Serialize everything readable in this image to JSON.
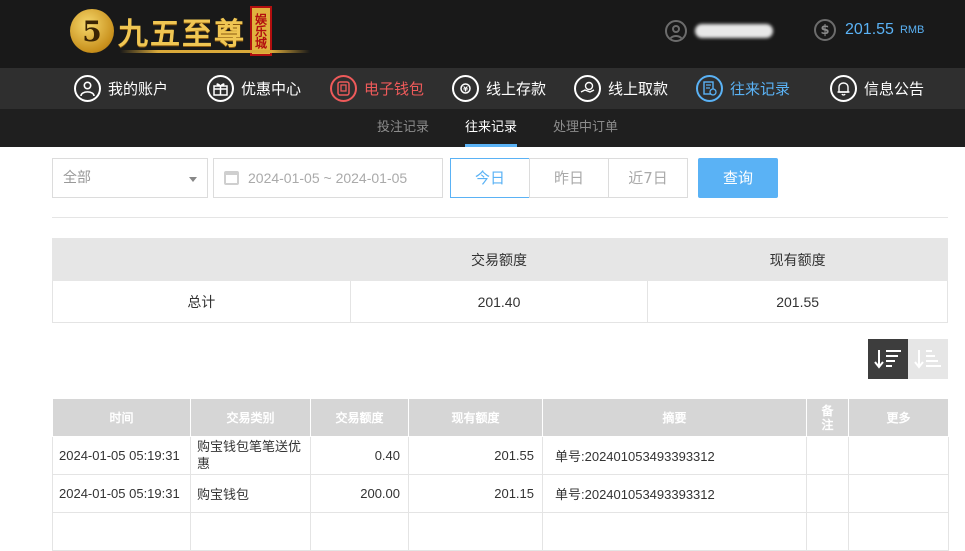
{
  "brand": {
    "logo_glyph": "5",
    "name": "九五至尊",
    "badge": "娱乐城"
  },
  "account": {
    "balance": "201.55",
    "currency": "RMB"
  },
  "nav": [
    {
      "label": "我的账户",
      "icon": "user-icon"
    },
    {
      "label": "优惠中心",
      "icon": "gift-icon"
    },
    {
      "label": "电子钱包",
      "icon": "wallet-icon"
    },
    {
      "label": "线上存款",
      "icon": "deposit-icon"
    },
    {
      "label": "线上取款",
      "icon": "withdraw-icon"
    },
    {
      "label": "往来记录",
      "icon": "records-icon"
    },
    {
      "label": "信息公告",
      "icon": "bell-icon"
    }
  ],
  "subnav": [
    {
      "label": "投注记录"
    },
    {
      "label": "往来记录"
    },
    {
      "label": "处理中订单"
    }
  ],
  "filters": {
    "type_selected": "全部",
    "date_range": "2024-01-05 ~ 2024-01-05",
    "quick_ranges": [
      "今日",
      "昨日",
      "近7日"
    ],
    "query_label": "查询"
  },
  "summary": {
    "headers": [
      "",
      "交易额度",
      "现有额度"
    ],
    "row": {
      "label": "总计",
      "trade_amount": "201.40",
      "current_amount": "201.55"
    }
  },
  "records": {
    "headers": [
      "时间",
      "交易类别",
      "交易额度",
      "现有额度",
      "摘要",
      "备注",
      "更多"
    ],
    "rows": [
      {
        "time": "2024-01-05 05:19:31",
        "type": "购宝钱包笔笔送优惠",
        "amount": "0.40",
        "balance": "201.55",
        "memo": "单号:202401053493393312",
        "remark": "",
        "more": ""
      },
      {
        "time": "2024-01-05 05:19:31",
        "type": "购宝钱包",
        "amount": "200.00",
        "balance": "201.15",
        "memo": "单号:202401053493393312",
        "remark": "",
        "more": ""
      }
    ]
  },
  "colors": {
    "accent_blue": "#5ab2f5",
    "accent_red": "#ee5a5a",
    "header_bg": "#191919",
    "nav_bg": "#2f2f2f"
  }
}
